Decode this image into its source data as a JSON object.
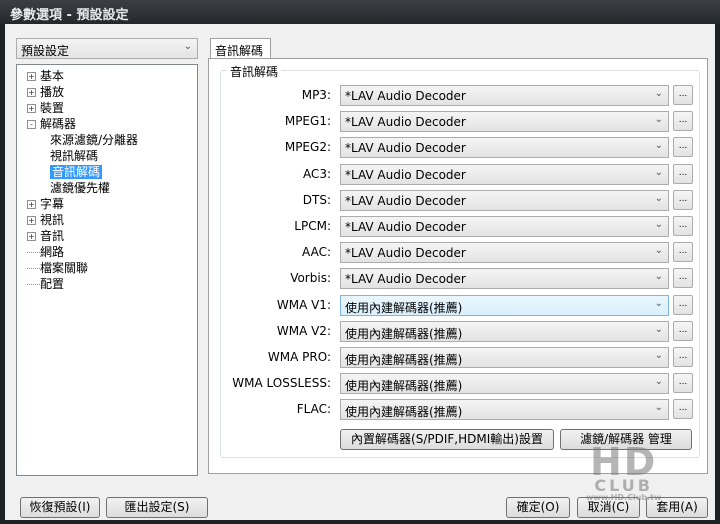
{
  "window": {
    "title": "參數選項 - 預設設定"
  },
  "profile_select": {
    "value": "預設設定"
  },
  "tree": [
    {
      "label": "基本",
      "level": 0,
      "expander": "+"
    },
    {
      "label": "播放",
      "level": 0,
      "expander": "+"
    },
    {
      "label": "裝置",
      "level": 0,
      "expander": "+"
    },
    {
      "label": "解碼器",
      "level": 0,
      "expander": "-"
    },
    {
      "label": "來源濾鏡/分離器",
      "level": 1,
      "expander": ""
    },
    {
      "label": "視訊解碼",
      "level": 1,
      "expander": ""
    },
    {
      "label": "音訊解碼",
      "level": 1,
      "expander": "",
      "selected": true
    },
    {
      "label": "濾鏡優先權",
      "level": 1,
      "expander": ""
    },
    {
      "label": "字幕",
      "level": 0,
      "expander": "+"
    },
    {
      "label": "視訊",
      "level": 0,
      "expander": "+"
    },
    {
      "label": "音訊",
      "level": 0,
      "expander": "+"
    },
    {
      "label": "網路",
      "level": 0,
      "expander": ""
    },
    {
      "label": "檔案關聯",
      "level": 0,
      "expander": ""
    },
    {
      "label": "配置",
      "level": 0,
      "expander": ""
    }
  ],
  "tab": {
    "label": "音訊解碼"
  },
  "group": {
    "title": "音訊解碼"
  },
  "rows": [
    {
      "label": "MP3:",
      "value": "*LAV Audio Decoder"
    },
    {
      "label": "MPEG1:",
      "value": "*LAV Audio Decoder"
    },
    {
      "label": "MPEG2:",
      "value": "*LAV Audio Decoder"
    },
    {
      "label": "AC3:",
      "value": "*LAV Audio Decoder"
    },
    {
      "label": "DTS:",
      "value": "*LAV Audio Decoder"
    },
    {
      "label": "LPCM:",
      "value": "*LAV Audio Decoder"
    },
    {
      "label": "AAC:",
      "value": "*LAV Audio Decoder"
    },
    {
      "label": "Vorbis:",
      "value": "*LAV Audio Decoder"
    },
    {
      "label": "WMA V1:",
      "value": "使用內建解碼器(推薦)",
      "focused": true
    },
    {
      "label": "WMA V2:",
      "value": "使用內建解碼器(推薦)"
    },
    {
      "label": "WMA PRO:",
      "value": "使用內建解碼器(推薦)"
    },
    {
      "label": "WMA LOSSLESS:",
      "value": "使用內建解碼器(推薦)"
    },
    {
      "label": "FLAC:",
      "value": "使用內建解碼器(推薦)"
    }
  ],
  "ellipsis": "...",
  "buttons": {
    "builtin_settings": "內置解碼器(S/PDIF,HDMI輸出)設置",
    "filter_manager": "濾鏡/解碼器 管理",
    "restore": "恢復預設(I)",
    "export": "匯出設定(S)",
    "ok": "確定(O)",
    "cancel": "取消(C)",
    "apply": "套用(A)"
  },
  "watermark": {
    "logo": "HD",
    "sub": "CLUB",
    "url": "www.HD.Club.tw"
  }
}
